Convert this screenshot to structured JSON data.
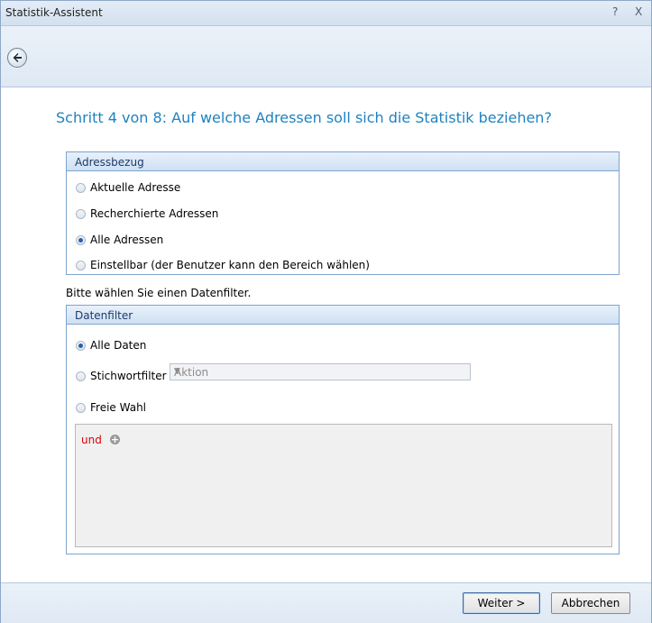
{
  "window": {
    "title": "Statistik-Assistent",
    "help_glyph": "?",
    "close_glyph": "X"
  },
  "toolbar": {
    "back_icon": "back-arrow-icon"
  },
  "heading": "Schritt 4 von 8: Auf welche Adressen soll sich die Statistik beziehen?",
  "adressbezug": {
    "title": "Adressbezug",
    "options": [
      {
        "label": "Aktuelle Adresse",
        "selected": false
      },
      {
        "label": "Recherchierte Adressen",
        "selected": false
      },
      {
        "label": "Alle Adressen",
        "selected": true
      },
      {
        "label": "Einstellbar (der Benutzer kann den Bereich wählen)",
        "selected": false
      }
    ]
  },
  "note": "Bitte wählen Sie einen Datenfilter.",
  "datenfilter": {
    "title": "Datenfilter",
    "options": [
      {
        "label": "Alle Daten",
        "selected": true
      },
      {
        "label": "Stichwortfilter",
        "selected": false
      },
      {
        "label": "Freie Wahl",
        "selected": false
      }
    ],
    "combo_value": "Aktion",
    "filter_text": "und",
    "add_glyph": "+"
  },
  "buttons": {
    "next": "Weiter >",
    "cancel": "Abbrechen"
  }
}
